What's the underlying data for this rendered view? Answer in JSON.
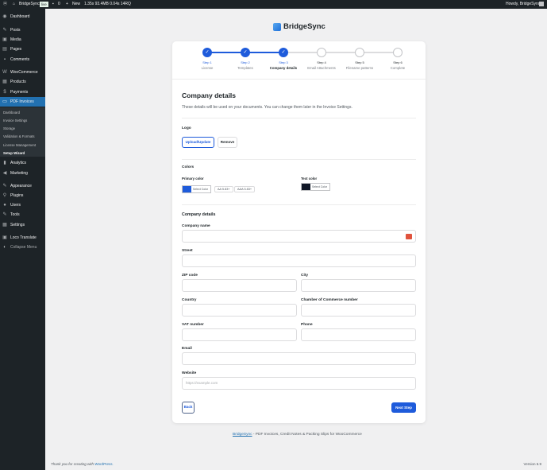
{
  "adminbar": {
    "site": "BridgeSync",
    "badge": "live",
    "comments": "0",
    "new": "New",
    "stats": "1.35s  93.4MB  0.04s  14RQ",
    "greeting": "Howdy, BridgeSync"
  },
  "sidebar": {
    "items": [
      "Dashboard",
      "Posts",
      "Media",
      "Pages",
      "Comments",
      "WooCommerce",
      "Products",
      "Payments",
      "PDF Invoices",
      "Analytics",
      "Marketing",
      "Appearance",
      "Plugins",
      "Users",
      "Tools",
      "Settings",
      "Loco Translate",
      "Collapse Menu"
    ],
    "submenu": [
      "Dashboard",
      "Invoice Settings",
      "Storage",
      "Validation & Formats",
      "License Management",
      "Setup Wizard"
    ]
  },
  "brand": "BridgeSync",
  "steps": [
    {
      "num": "Step 1",
      "name": "License",
      "state": "done"
    },
    {
      "num": "Step 2",
      "name": "Templates",
      "state": "done"
    },
    {
      "num": "Step 3",
      "name": "Company details",
      "state": "current"
    },
    {
      "num": "Step 4",
      "name": "Email Attachments",
      "state": "todo"
    },
    {
      "num": "Step 5",
      "name": "Filename patterns",
      "state": "todo"
    },
    {
      "num": "Step 6",
      "name": "Complete",
      "state": "todo"
    }
  ],
  "main": {
    "title": "Company details",
    "description": "These details will be used on your documents. You can change them later in the Invoice Settings.",
    "logo": {
      "label": "Logo",
      "upload": "Upload/Update",
      "remove": "Remove"
    },
    "colors": {
      "label": "Colors",
      "primary_label": "Primary color",
      "primary": "#1e5bdb",
      "select": "Select Color",
      "aa": "AA 5.83+",
      "aaa": "AAA 5.83+",
      "text_label": "Text color",
      "text": "#111827"
    },
    "company": {
      "label": "Company details",
      "fields": {
        "company_name": "Company name",
        "street": "Street",
        "zip": "ZIP code",
        "city": "City",
        "country": "Country",
        "coc": "Chamber of Commerce number",
        "vat": "VAT number",
        "phone": "Phone",
        "email": "Email",
        "website": "Website",
        "website_placeholder": "https://example.com"
      }
    },
    "back": "Back",
    "next": "Next Step"
  },
  "footer": {
    "link": "BridgeSync",
    "text": " - PDF Invoices, Credit Notes & Packing Slips for WooCommerce",
    "thanks": "Thank you for creating with ",
    "wp": "WordPress.",
    "version": "Version 6.9"
  }
}
